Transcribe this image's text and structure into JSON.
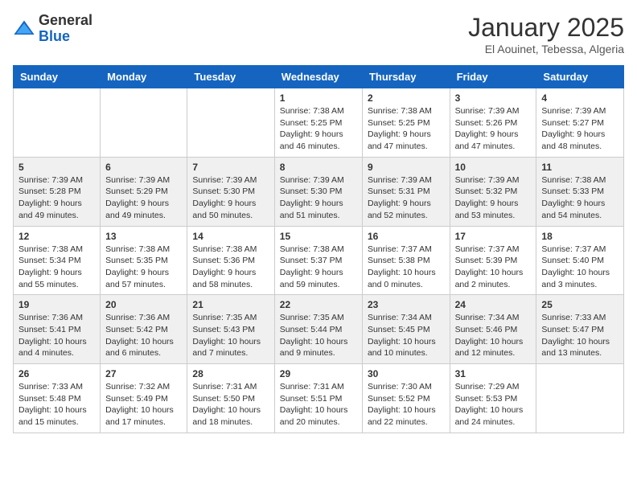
{
  "header": {
    "logo_general": "General",
    "logo_blue": "Blue",
    "month": "January 2025",
    "location": "El Aouinet, Tebessa, Algeria"
  },
  "weekdays": [
    "Sunday",
    "Monday",
    "Tuesday",
    "Wednesday",
    "Thursday",
    "Friday",
    "Saturday"
  ],
  "weeks": [
    [
      {
        "day": "",
        "sunrise": "",
        "sunset": "",
        "daylight": ""
      },
      {
        "day": "",
        "sunrise": "",
        "sunset": "",
        "daylight": ""
      },
      {
        "day": "",
        "sunrise": "",
        "sunset": "",
        "daylight": ""
      },
      {
        "day": "1",
        "sunrise": "Sunrise: 7:38 AM",
        "sunset": "Sunset: 5:25 PM",
        "daylight": "Daylight: 9 hours and 46 minutes."
      },
      {
        "day": "2",
        "sunrise": "Sunrise: 7:38 AM",
        "sunset": "Sunset: 5:25 PM",
        "daylight": "Daylight: 9 hours and 47 minutes."
      },
      {
        "day": "3",
        "sunrise": "Sunrise: 7:39 AM",
        "sunset": "Sunset: 5:26 PM",
        "daylight": "Daylight: 9 hours and 47 minutes."
      },
      {
        "day": "4",
        "sunrise": "Sunrise: 7:39 AM",
        "sunset": "Sunset: 5:27 PM",
        "daylight": "Daylight: 9 hours and 48 minutes."
      }
    ],
    [
      {
        "day": "5",
        "sunrise": "Sunrise: 7:39 AM",
        "sunset": "Sunset: 5:28 PM",
        "daylight": "Daylight: 9 hours and 49 minutes."
      },
      {
        "day": "6",
        "sunrise": "Sunrise: 7:39 AM",
        "sunset": "Sunset: 5:29 PM",
        "daylight": "Daylight: 9 hours and 49 minutes."
      },
      {
        "day": "7",
        "sunrise": "Sunrise: 7:39 AM",
        "sunset": "Sunset: 5:30 PM",
        "daylight": "Daylight: 9 hours and 50 minutes."
      },
      {
        "day": "8",
        "sunrise": "Sunrise: 7:39 AM",
        "sunset": "Sunset: 5:30 PM",
        "daylight": "Daylight: 9 hours and 51 minutes."
      },
      {
        "day": "9",
        "sunrise": "Sunrise: 7:39 AM",
        "sunset": "Sunset: 5:31 PM",
        "daylight": "Daylight: 9 hours and 52 minutes."
      },
      {
        "day": "10",
        "sunrise": "Sunrise: 7:39 AM",
        "sunset": "Sunset: 5:32 PM",
        "daylight": "Daylight: 9 hours and 53 minutes."
      },
      {
        "day": "11",
        "sunrise": "Sunrise: 7:38 AM",
        "sunset": "Sunset: 5:33 PM",
        "daylight": "Daylight: 9 hours and 54 minutes."
      }
    ],
    [
      {
        "day": "12",
        "sunrise": "Sunrise: 7:38 AM",
        "sunset": "Sunset: 5:34 PM",
        "daylight": "Daylight: 9 hours and 55 minutes."
      },
      {
        "day": "13",
        "sunrise": "Sunrise: 7:38 AM",
        "sunset": "Sunset: 5:35 PM",
        "daylight": "Daylight: 9 hours and 57 minutes."
      },
      {
        "day": "14",
        "sunrise": "Sunrise: 7:38 AM",
        "sunset": "Sunset: 5:36 PM",
        "daylight": "Daylight: 9 hours and 58 minutes."
      },
      {
        "day": "15",
        "sunrise": "Sunrise: 7:38 AM",
        "sunset": "Sunset: 5:37 PM",
        "daylight": "Daylight: 9 hours and 59 minutes."
      },
      {
        "day": "16",
        "sunrise": "Sunrise: 7:37 AM",
        "sunset": "Sunset: 5:38 PM",
        "daylight": "Daylight: 10 hours and 0 minutes."
      },
      {
        "day": "17",
        "sunrise": "Sunrise: 7:37 AM",
        "sunset": "Sunset: 5:39 PM",
        "daylight": "Daylight: 10 hours and 2 minutes."
      },
      {
        "day": "18",
        "sunrise": "Sunrise: 7:37 AM",
        "sunset": "Sunset: 5:40 PM",
        "daylight": "Daylight: 10 hours and 3 minutes."
      }
    ],
    [
      {
        "day": "19",
        "sunrise": "Sunrise: 7:36 AM",
        "sunset": "Sunset: 5:41 PM",
        "daylight": "Daylight: 10 hours and 4 minutes."
      },
      {
        "day": "20",
        "sunrise": "Sunrise: 7:36 AM",
        "sunset": "Sunset: 5:42 PM",
        "daylight": "Daylight: 10 hours and 6 minutes."
      },
      {
        "day": "21",
        "sunrise": "Sunrise: 7:35 AM",
        "sunset": "Sunset: 5:43 PM",
        "daylight": "Daylight: 10 hours and 7 minutes."
      },
      {
        "day": "22",
        "sunrise": "Sunrise: 7:35 AM",
        "sunset": "Sunset: 5:44 PM",
        "daylight": "Daylight: 10 hours and 9 minutes."
      },
      {
        "day": "23",
        "sunrise": "Sunrise: 7:34 AM",
        "sunset": "Sunset: 5:45 PM",
        "daylight": "Daylight: 10 hours and 10 minutes."
      },
      {
        "day": "24",
        "sunrise": "Sunrise: 7:34 AM",
        "sunset": "Sunset: 5:46 PM",
        "daylight": "Daylight: 10 hours and 12 minutes."
      },
      {
        "day": "25",
        "sunrise": "Sunrise: 7:33 AM",
        "sunset": "Sunset: 5:47 PM",
        "daylight": "Daylight: 10 hours and 13 minutes."
      }
    ],
    [
      {
        "day": "26",
        "sunrise": "Sunrise: 7:33 AM",
        "sunset": "Sunset: 5:48 PM",
        "daylight": "Daylight: 10 hours and 15 minutes."
      },
      {
        "day": "27",
        "sunrise": "Sunrise: 7:32 AM",
        "sunset": "Sunset: 5:49 PM",
        "daylight": "Daylight: 10 hours and 17 minutes."
      },
      {
        "day": "28",
        "sunrise": "Sunrise: 7:31 AM",
        "sunset": "Sunset: 5:50 PM",
        "daylight": "Daylight: 10 hours and 18 minutes."
      },
      {
        "day": "29",
        "sunrise": "Sunrise: 7:31 AM",
        "sunset": "Sunset: 5:51 PM",
        "daylight": "Daylight: 10 hours and 20 minutes."
      },
      {
        "day": "30",
        "sunrise": "Sunrise: 7:30 AM",
        "sunset": "Sunset: 5:52 PM",
        "daylight": "Daylight: 10 hours and 22 minutes."
      },
      {
        "day": "31",
        "sunrise": "Sunrise: 7:29 AM",
        "sunset": "Sunset: 5:53 PM",
        "daylight": "Daylight: 10 hours and 24 minutes."
      },
      {
        "day": "",
        "sunrise": "",
        "sunset": "",
        "daylight": ""
      }
    ]
  ]
}
